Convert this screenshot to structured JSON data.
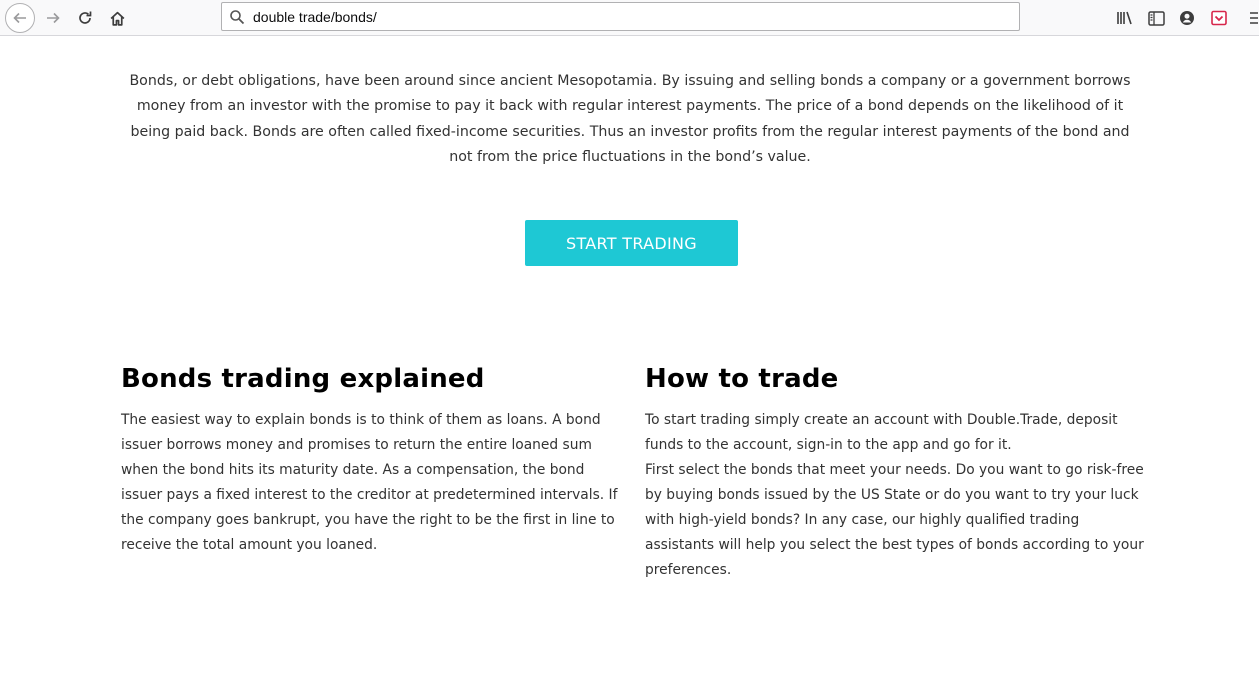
{
  "browser": {
    "url": "double trade/bonds/",
    "icons": {
      "back": "back-arrow-icon",
      "forward": "forward-arrow-icon",
      "reload": "reload-icon",
      "home": "home-icon",
      "search": "search-icon",
      "library": "library-icon",
      "sidebar": "sidebar-icon",
      "account": "account-icon",
      "pocket": "pocket-icon",
      "menu": "menu-icon"
    }
  },
  "intro": {
    "text": "Bonds, or debt obligations, have been around since ancient Mesopotamia. By issuing and selling bonds a company or a government borrows money from an investor with the promise to pay it back with regular interest payments. The price of a bond depends on the likelihood of it being paid back. Bonds are often called fixed-income securities. Thus an investor profits from the regular interest payments of the bond and not from the price fluctuations in the bond’s value."
  },
  "cta": {
    "label": "START TRADING",
    "color": "#1ec8d4"
  },
  "sections": {
    "left": {
      "title": "Bonds trading explained",
      "body": "The easiest way to explain bonds is to think of them as loans. A bond issuer borrows money and promises to return the entire loaned sum when the bond hits its maturity date. As a compensation, the bond issuer pays a fixed interest to the creditor at predetermined intervals. If the company goes bankrupt, you have the right to be the first in line to receive the total amount you loaned."
    },
    "right": {
      "title": "How to trade",
      "body1": "To start trading simply create an account with Double.Trade, deposit funds to the account, sign-in to the app and go for it.",
      "body2": "First select the bonds that meet your needs. Do you want to go risk-free by buying bonds issued by the US State or do you want to try your luck with high-yield bonds? In any case, our highly qualified trading assistants will help you select the best types of bonds according to your preferences."
    }
  }
}
